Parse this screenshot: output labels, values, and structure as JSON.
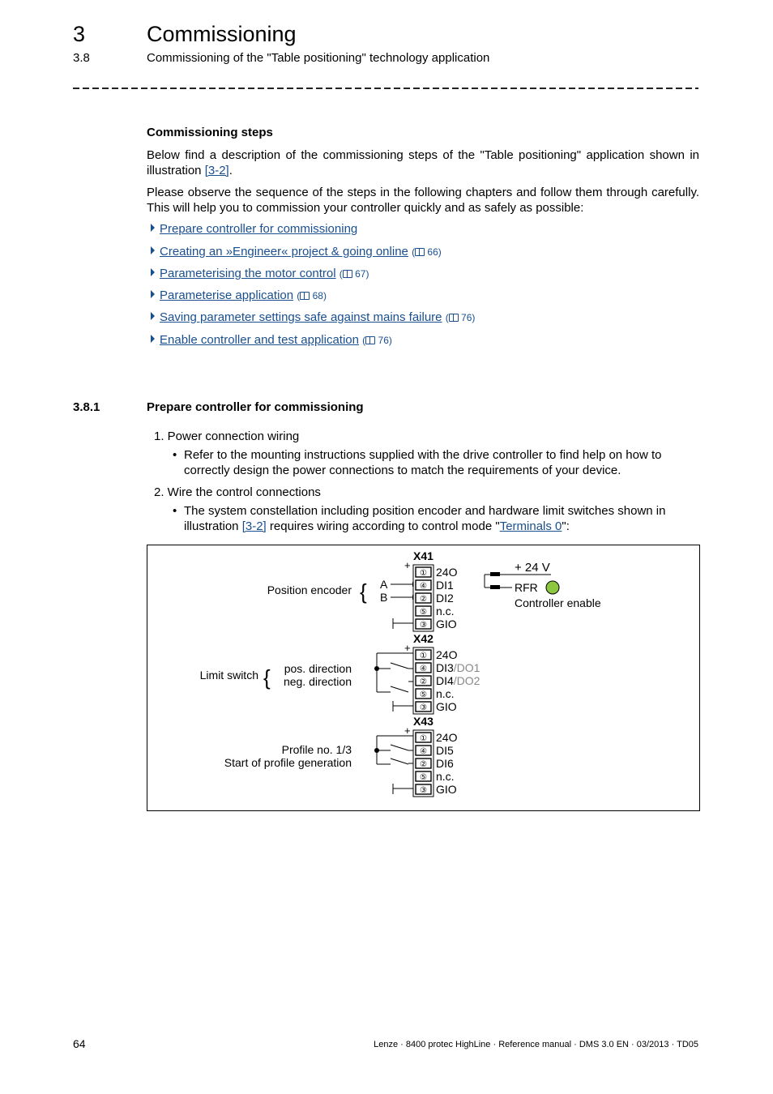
{
  "header": {
    "chapter_number": "3",
    "chapter_title": "Commissioning",
    "section_number": "3.8",
    "section_title": "Commissioning of the \"Table positioning\" technology application"
  },
  "commissioning_steps": {
    "heading": "Commissioning steps",
    "intro_1_text": "Below find a description of the commissioning steps of the \"Table positioning\" application shown in illustration ",
    "intro_1_link": "[3-2]",
    "intro_1_end": ".",
    "intro_2": "Please observe the sequence of the steps in the following chapters and follow them through carefully. This will help you to commission your controller quickly and as safely as possible:",
    "links": [
      {
        "label": "Prepare controller for commissioning",
        "page": ""
      },
      {
        "label": "Creating an »Engineer« project & going online",
        "page": "66"
      },
      {
        "label": "Parameterising the motor control",
        "page": "67"
      },
      {
        "label": "Parameterise application",
        "page": "68"
      },
      {
        "label": "Saving parameter settings safe against mains failure",
        "page": "76"
      },
      {
        "label": "Enable controller and test application",
        "page": "76"
      }
    ]
  },
  "subsection": {
    "number": "3.8.1",
    "title": "Prepare controller for commissioning",
    "steps": [
      {
        "label": "1. Power connection wiring",
        "bullet": "Refer to the mounting instructions supplied with the drive controller to find help on how to correctly design the power connections to match the requirements of your device."
      },
      {
        "label": "2. Wire the control connections",
        "bullet_start": "The system constellation including position encoder and hardware limit switches shown in illustration ",
        "bullet_link_1": "[3-2]",
        "bullet_mid": " requires wiring according to control mode \"",
        "bullet_link_2": "Terminals 0",
        "bullet_end": "\":"
      }
    ]
  },
  "diagram": {
    "connectors": [
      {
        "name": "X41",
        "pins": [
          {
            "num": "①",
            "label": "24O",
            "extra": ""
          },
          {
            "num": "④",
            "label": "DI1",
            "extra": ""
          },
          {
            "num": "②",
            "label": "DI2",
            "extra": ""
          },
          {
            "num": "⑤",
            "label": "n.c.",
            "extra": ""
          },
          {
            "num": "③",
            "label": "GIO",
            "extra": ""
          }
        ]
      },
      {
        "name": "X42",
        "pins": [
          {
            "num": "①",
            "label": "24O",
            "extra": ""
          },
          {
            "num": "④",
            "label": "DI3",
            "extra": "/DO1"
          },
          {
            "num": "②",
            "label": "DI4",
            "extra": "/DO2"
          },
          {
            "num": "⑤",
            "label": "n.c.",
            "extra": ""
          },
          {
            "num": "③",
            "label": "GIO",
            "extra": ""
          }
        ]
      },
      {
        "name": "X43",
        "pins": [
          {
            "num": "①",
            "label": "24O",
            "extra": ""
          },
          {
            "num": "④",
            "label": "DI5",
            "extra": ""
          },
          {
            "num": "②",
            "label": "DI6",
            "extra": ""
          },
          {
            "num": "⑤",
            "label": "n.c.",
            "extra": ""
          },
          {
            "num": "③",
            "label": "GIO",
            "extra": ""
          }
        ]
      }
    ],
    "plus_sign": "+",
    "position_encoder": "Position encoder",
    "encoder_a": "A",
    "encoder_b": "B",
    "limit_switch": "Limit switch",
    "pos_direction": "pos. direction",
    "neg_direction": "neg. direction",
    "profile_no": "Profile no. 1/3",
    "start_profile": "Start of profile generation",
    "supply": "+ 24 V",
    "rfr": "RFR",
    "controller_enable": "Controller enable",
    "led_color": "#8dc63f",
    "secondary_text_color": "#888888"
  },
  "footer": {
    "page_number": "64",
    "info": "Lenze · 8400 protec HighLine · Reference manual · DMS 3.0 EN · 03/2013 · TD05"
  }
}
